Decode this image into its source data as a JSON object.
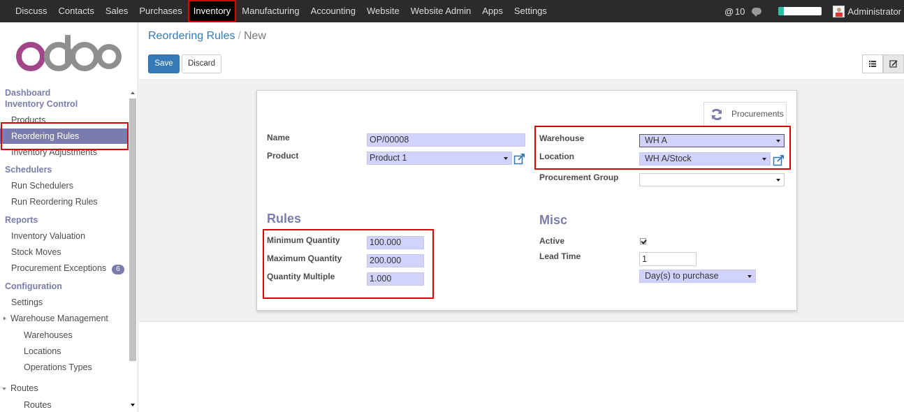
{
  "top_menu": [
    "Discuss",
    "Contacts",
    "Sales",
    "Purchases",
    "Inventory",
    "Manufacturing",
    "Accounting",
    "Website",
    "Website Admin",
    "Apps",
    "Settings"
  ],
  "top_right": {
    "message_count": "10",
    "user": "Administrator",
    "progress": 0.12
  },
  "sidebar": {
    "logo_text": "odoo",
    "dashboard": "Dashboard",
    "inventory_control": "Inventory Control",
    "products": "Products",
    "reordering_rules": "Reordering Rules",
    "inventory_adjustments": "Inventory Adjustments",
    "schedulers": "Schedulers",
    "run_schedulers": "Run Schedulers",
    "run_reordering_rules": "Run Reordering Rules",
    "reports": "Reports",
    "inventory_valuation": "Inventory Valuation",
    "stock_moves": "Stock Moves",
    "procurement_exceptions": "Procurement Exceptions",
    "procurement_exceptions_count": "6",
    "configuration": "Configuration",
    "settings": "Settings",
    "warehouse_management": "Warehouse Management",
    "warehouses": "Warehouses",
    "locations": "Locations",
    "operations_types": "Operations Types",
    "routes_head": "Routes",
    "routes": "Routes"
  },
  "breadcrumb": {
    "parent": "Reordering Rules",
    "current": "New"
  },
  "buttons": {
    "save": "Save",
    "discard": "Discard"
  },
  "smart_button": {
    "label": "Procurements"
  },
  "form": {
    "name_label": "Name",
    "name_value": "OP/00008",
    "product_label": "Product",
    "product_value": "Product 1",
    "warehouse_label": "Warehouse",
    "warehouse_value": "WH A",
    "location_label": "Location",
    "location_value": "WH A/Stock",
    "procurement_group_label": "Procurement Group",
    "procurement_group_value": "",
    "rules_title": "Rules",
    "min_qty_label": "Minimum Quantity",
    "min_qty_value": "100.000",
    "max_qty_label": "Maximum Quantity",
    "max_qty_value": "200.000",
    "qty_multiple_label": "Quantity Multiple",
    "qty_multiple_value": "1.000",
    "misc_title": "Misc",
    "active_label": "Active",
    "active_value": true,
    "lead_time_label": "Lead Time",
    "lead_time_value": "1",
    "lead_type_value": "Day(s) to purchase"
  },
  "colors": {
    "brand": "#7c7bad",
    "primary": "#337ab7",
    "highlight": "#d90000",
    "required_field": "#d2d2ff"
  }
}
